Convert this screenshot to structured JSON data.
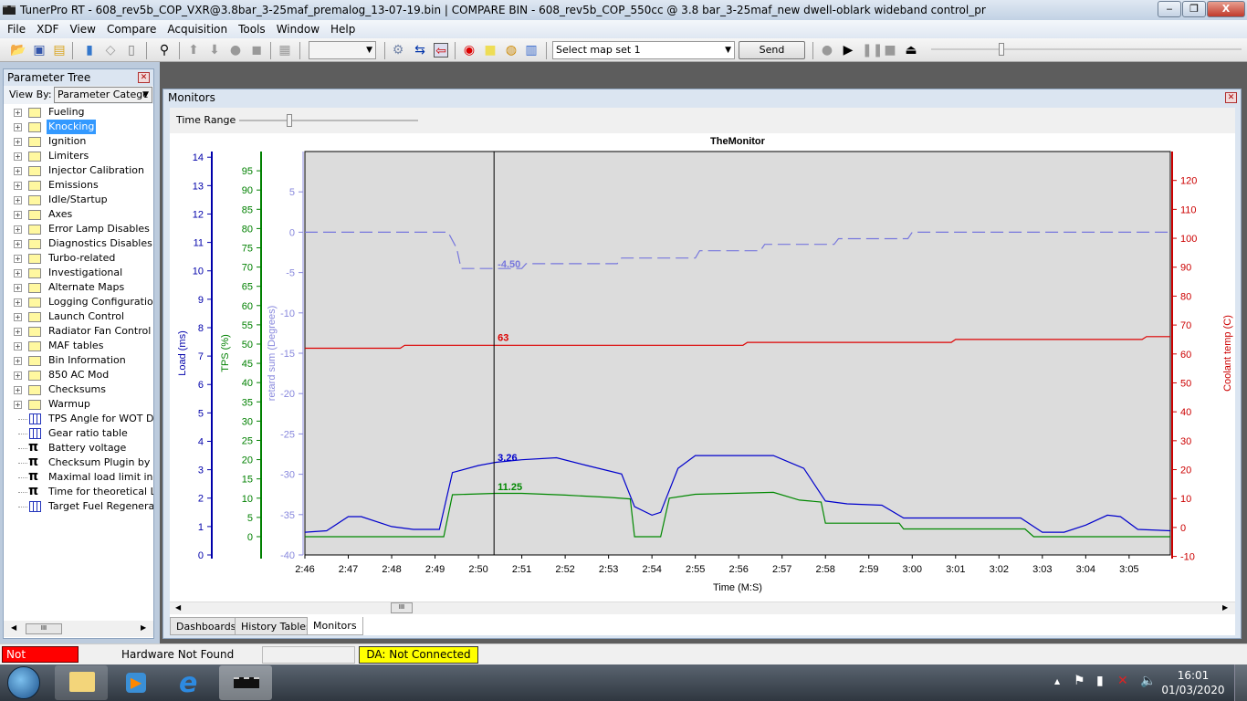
{
  "window": {
    "title": "TunerPro RT - 608_rev5b_COP_VXR@3.8bar_3-25maf_premalog_13-07-19.bin | COMPARE BIN - 608_rev5b_COP_550cc @ 3.8 bar_3-25maf_new dwell-oblark wideband control_pr",
    "minimize": "‒",
    "restore": "❐",
    "close": "X"
  },
  "menu": [
    "File",
    "XDF",
    "View",
    "Compare",
    "Acquisition",
    "Tools",
    "Window",
    "Help"
  ],
  "toolbar": {
    "map_set": "Select map set 1",
    "send": "Send",
    "combo_empty": ""
  },
  "tree": {
    "title": "Parameter Tree",
    "view_by_label": "View By:",
    "view_by_value": "Parameter Categc",
    "folders": [
      "Fueling",
      "Knocking",
      "Ignition",
      "Limiters",
      "Injector Calibration",
      "Emissions",
      "Idle/Startup",
      "Axes",
      "Error Lamp Disables (you",
      "Diagnostics Disables",
      "Turbo-related",
      "Investigational",
      "Alternate Maps",
      "Logging Configuration",
      "Launch Control",
      "Radiator Fan Control",
      "MAF tables",
      "Bin Information",
      "850 AC Mod",
      "Checksums",
      "Warmup"
    ],
    "selected": "Knocking",
    "leaves": [
      {
        "label": "TPS Angle for WOT Dete",
        "icon": "table-icon"
      },
      {
        "label": "Gear ratio table",
        "icon": "table-icon"
      },
      {
        "label": "Battery voltage",
        "icon": "pi-icon"
      },
      {
        "label": "Checksum Plugin by Simp",
        "icon": "pi-icon"
      },
      {
        "label": "Maximal load limit in calcu",
        "icon": "pi-icon"
      },
      {
        "label": "Time for theoretical Laml",
        "icon": "pi-icon"
      },
      {
        "label": "Target Fuel Regeneratio",
        "icon": "table-icon"
      }
    ]
  },
  "monitors": {
    "title": "Monitors",
    "time_range": "Time Range",
    "tabs": [
      "Dashboards",
      "History Tables",
      "Monitors"
    ],
    "active_tab": "Monitors"
  },
  "chart_data": {
    "type": "line",
    "title": "TheMonitor",
    "xlabel": "Time (M:S)",
    "xlim": [
      "2:46",
      "3:05.95"
    ],
    "xticks": [
      "2:46",
      "2:47",
      "2:48",
      "2:49",
      "2:50",
      "2:51",
      "2:52",
      "2:53",
      "2:54",
      "2:55",
      "2:56",
      "2:57",
      "2:58",
      "2:59",
      "3:00",
      "3:01",
      "3:02",
      "3:03",
      "3:04",
      "3:05"
    ],
    "cursor": "2:50.36",
    "background": "#dcdcdc",
    "axes": [
      {
        "id": "load",
        "label": "Load (ms)",
        "color": "#0000aa",
        "range": [
          0,
          14.2
        ],
        "ticks": [
          0,
          1,
          2,
          3,
          4,
          5,
          6,
          7,
          8,
          9,
          10,
          11,
          12,
          13,
          14
        ],
        "side": "left"
      },
      {
        "id": "tps",
        "label": "TPS (%)",
        "color": "#008000",
        "range": [
          -4.75,
          100
        ],
        "ticks": [
          0,
          5,
          10,
          15,
          20,
          25,
          30,
          35,
          40,
          45,
          50,
          55,
          60,
          65,
          70,
          75,
          80,
          85,
          90,
          95
        ],
        "side": "left"
      },
      {
        "id": "retard",
        "label": "retard sum (Degrees)",
        "color": "#8888dd",
        "range": [
          -40,
          10
        ],
        "ticks": [
          -40,
          -35,
          -30,
          -25,
          -20,
          -15,
          -10,
          -5,
          0,
          5
        ],
        "side": "left"
      },
      {
        "id": "coolant",
        "label": "Coolant temp (C)",
        "color": "#cc0000",
        "range": [
          -9.5,
          130
        ],
        "ticks": [
          -10,
          0,
          10,
          20,
          30,
          40,
          50,
          60,
          70,
          80,
          90,
          100,
          110,
          120
        ],
        "side": "right"
      }
    ],
    "series": [
      {
        "axis": "load",
        "cursor_value": "3.26",
        "color": "#0000cc",
        "dashed": false,
        "points": [
          [
            "2:46",
            0.8
          ],
          [
            "2:46.5",
            0.85
          ],
          [
            "2:47",
            1.35
          ],
          [
            "2:47.3",
            1.35
          ],
          [
            "2:48",
            1.0
          ],
          [
            "2:48.5",
            0.9
          ],
          [
            "2:49.1",
            0.9
          ],
          [
            "2:49.4",
            2.9
          ],
          [
            "2:50",
            3.15
          ],
          [
            "2:50.4",
            3.26
          ],
          [
            "2:51",
            3.35
          ],
          [
            "2:51.8",
            3.42
          ],
          [
            "2:52.5",
            3.15
          ],
          [
            "2:53.3",
            2.85
          ],
          [
            "2:53.6",
            1.7
          ],
          [
            "2:54",
            1.4
          ],
          [
            "2:54.2",
            1.5
          ],
          [
            "2:54.6",
            3.05
          ],
          [
            "2:55",
            3.5
          ],
          [
            "2:56.8",
            3.5
          ],
          [
            "2:57.5",
            3.05
          ],
          [
            "2:58",
            1.9
          ],
          [
            "2:58.5",
            1.8
          ],
          [
            "2:59.3",
            1.75
          ],
          [
            "2:59.8",
            1.3
          ],
          [
            "3:02.5",
            1.3
          ],
          [
            "3:03",
            0.8
          ],
          [
            "3:03.5",
            0.8
          ],
          [
            "3:04",
            1.05
          ],
          [
            "3:04.5",
            1.4
          ],
          [
            "3:04.8",
            1.35
          ],
          [
            "3:05.2",
            0.9
          ],
          [
            "3:05.95",
            0.85
          ]
        ]
      },
      {
        "axis": "tps",
        "cursor_value": "11.25",
        "color": "#008800",
        "dashed": false,
        "points": [
          [
            "2:46",
            0
          ],
          [
            "2:49.2",
            0
          ],
          [
            "2:49.4",
            10.9
          ],
          [
            "2:50.4",
            11.25
          ],
          [
            "2:51",
            11.25
          ],
          [
            "2:52",
            10.8
          ],
          [
            "2:53",
            10.2
          ],
          [
            "2:53.5",
            9.8
          ],
          [
            "2:53.6",
            0
          ],
          [
            "2:54.2",
            0
          ],
          [
            "2:54.4",
            10
          ],
          [
            "2:55",
            11
          ],
          [
            "2:56.8",
            11.5
          ],
          [
            "2:57.4",
            9.5
          ],
          [
            "2:57.9",
            9
          ],
          [
            "2:58",
            3.5
          ],
          [
            "2:59.7",
            3.5
          ],
          [
            "2:59.8",
            2
          ],
          [
            "3:02.6",
            2
          ],
          [
            "3:02.8",
            0
          ],
          [
            "3:05.95",
            0
          ]
        ]
      },
      {
        "axis": "retard",
        "cursor_value": "-4.50",
        "color": "#7777dd",
        "dashed": true,
        "points": [
          [
            "2:46",
            0
          ],
          [
            "2:49.3",
            0
          ],
          [
            "2:49.5",
            -2
          ],
          [
            "2:49.6",
            -4.5
          ],
          [
            "2:51",
            -4.5
          ],
          [
            "2:51.1",
            -3.9
          ],
          [
            "2:53.2",
            -3.9
          ],
          [
            "2:53.3",
            -3.2
          ],
          [
            "2:55",
            -3.2
          ],
          [
            "2:55.1",
            -2.3
          ],
          [
            "2:56.5",
            -2.3
          ],
          [
            "2:56.6",
            -1.5
          ],
          [
            "2:58.2",
            -1.5
          ],
          [
            "2:58.3",
            -0.8
          ],
          [
            "2:59.9",
            -0.8
          ],
          [
            "3:00",
            0
          ],
          [
            "3:05.95",
            0
          ]
        ]
      },
      {
        "axis": "coolant",
        "cursor_value": "63",
        "color": "#dd0000",
        "dashed": false,
        "points": [
          [
            "2:46",
            62
          ],
          [
            "2:48.2",
            62
          ],
          [
            "2:48.3",
            63
          ],
          [
            "2:56.1",
            63
          ],
          [
            "2:56.2",
            64
          ],
          [
            "3:00.9",
            64
          ],
          [
            "3:01",
            65
          ],
          [
            "3:05.3",
            65
          ],
          [
            "3:05.4",
            66
          ],
          [
            "3:05.95",
            66
          ]
        ]
      }
    ]
  },
  "status": {
    "emulation": "Not Emulating",
    "hardware": "Hardware Not Found",
    "da": "DA: Not Connected",
    "emulation_color": "#ff0000",
    "da_color": "#ffff00"
  },
  "taskbar": {
    "time": "16:01",
    "date": "01/03/2020"
  }
}
